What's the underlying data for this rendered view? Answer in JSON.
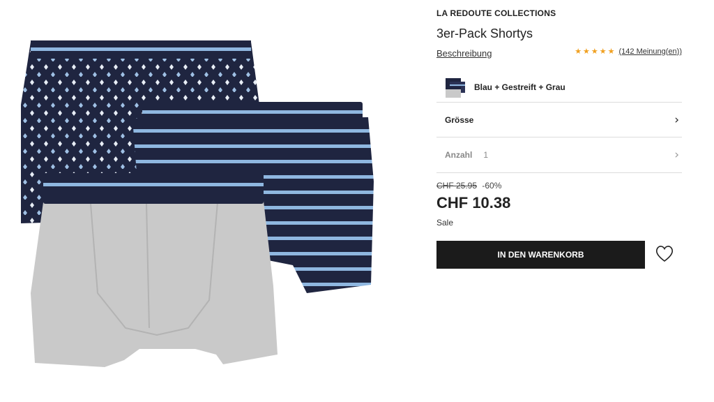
{
  "product": {
    "brand": "LA REDOUTE COLLECTIONS",
    "title": "3er-Pack Shortys",
    "description_link": "Beschreibung",
    "rating": {
      "stars": "★★★★★",
      "review_link": "(142 Meinung(en))",
      "star_color": "#f0a020"
    }
  },
  "variant": {
    "label": "Blau + Gestreift + Grau"
  },
  "options": {
    "size_label": "Grösse",
    "quantity_label": "Anzahl",
    "quantity_value": "1",
    "chevron": "›"
  },
  "pricing": {
    "old_price": "CHF 25.95",
    "discount": "-60%",
    "current_price": "CHF 10.38",
    "sale_label": "Sale"
  },
  "actions": {
    "add_to_cart": "IN DEN WARENKORB",
    "wishlist_icon": "heart-outline-icon"
  },
  "colors": {
    "navy": "#1f2540",
    "stripe_blue": "#8fb7e0",
    "grey": "#c9c9c9",
    "button_bg": "#1b1b1b"
  }
}
